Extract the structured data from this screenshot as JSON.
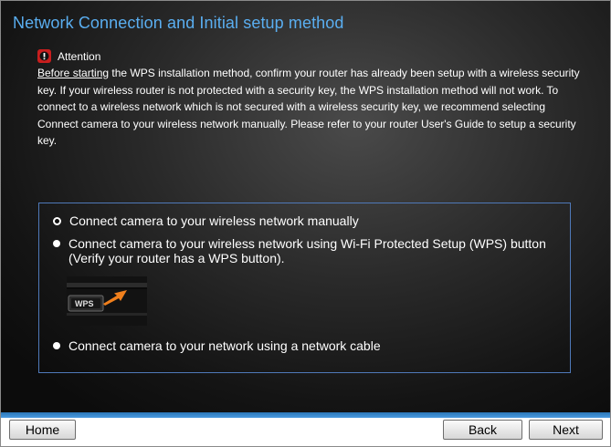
{
  "header": {
    "title": "Network Connection and Initial setup method"
  },
  "attention": {
    "label": "Attention",
    "lead_underlined": "Before starting",
    "text": " the WPS installation method, confirm your router has already been setup with a wireless security key. If your wireless router is not protected with a security key, the WPS installation method will not work. To connect to a wireless network which is not secured with a wireless security key, we recommend selecting Connect camera to your wireless network manually. Please refer to your router User's Guide to setup a security key."
  },
  "options": {
    "manual": {
      "label": "Connect camera to your wireless network manually",
      "selected": true
    },
    "wps": {
      "label": "Connect camera to your wireless network using Wi-Fi Protected Setup (WPS) button (Verify your router has a WPS button).",
      "selected": false,
      "image_text": "WPS"
    },
    "cable": {
      "label": "Connect camera to your network using a network cable",
      "selected": false
    }
  },
  "footer": {
    "home_label": "Home",
    "back_label": "Back",
    "next_label": "Next"
  },
  "colors": {
    "title": "#5aaef0",
    "accent_band": "#2a76b8",
    "options_border": "#4f79b9",
    "attention_icon": "#c81e1e"
  },
  "icons": {
    "attention": "exclamation-icon",
    "wps": "wps-button-image"
  }
}
